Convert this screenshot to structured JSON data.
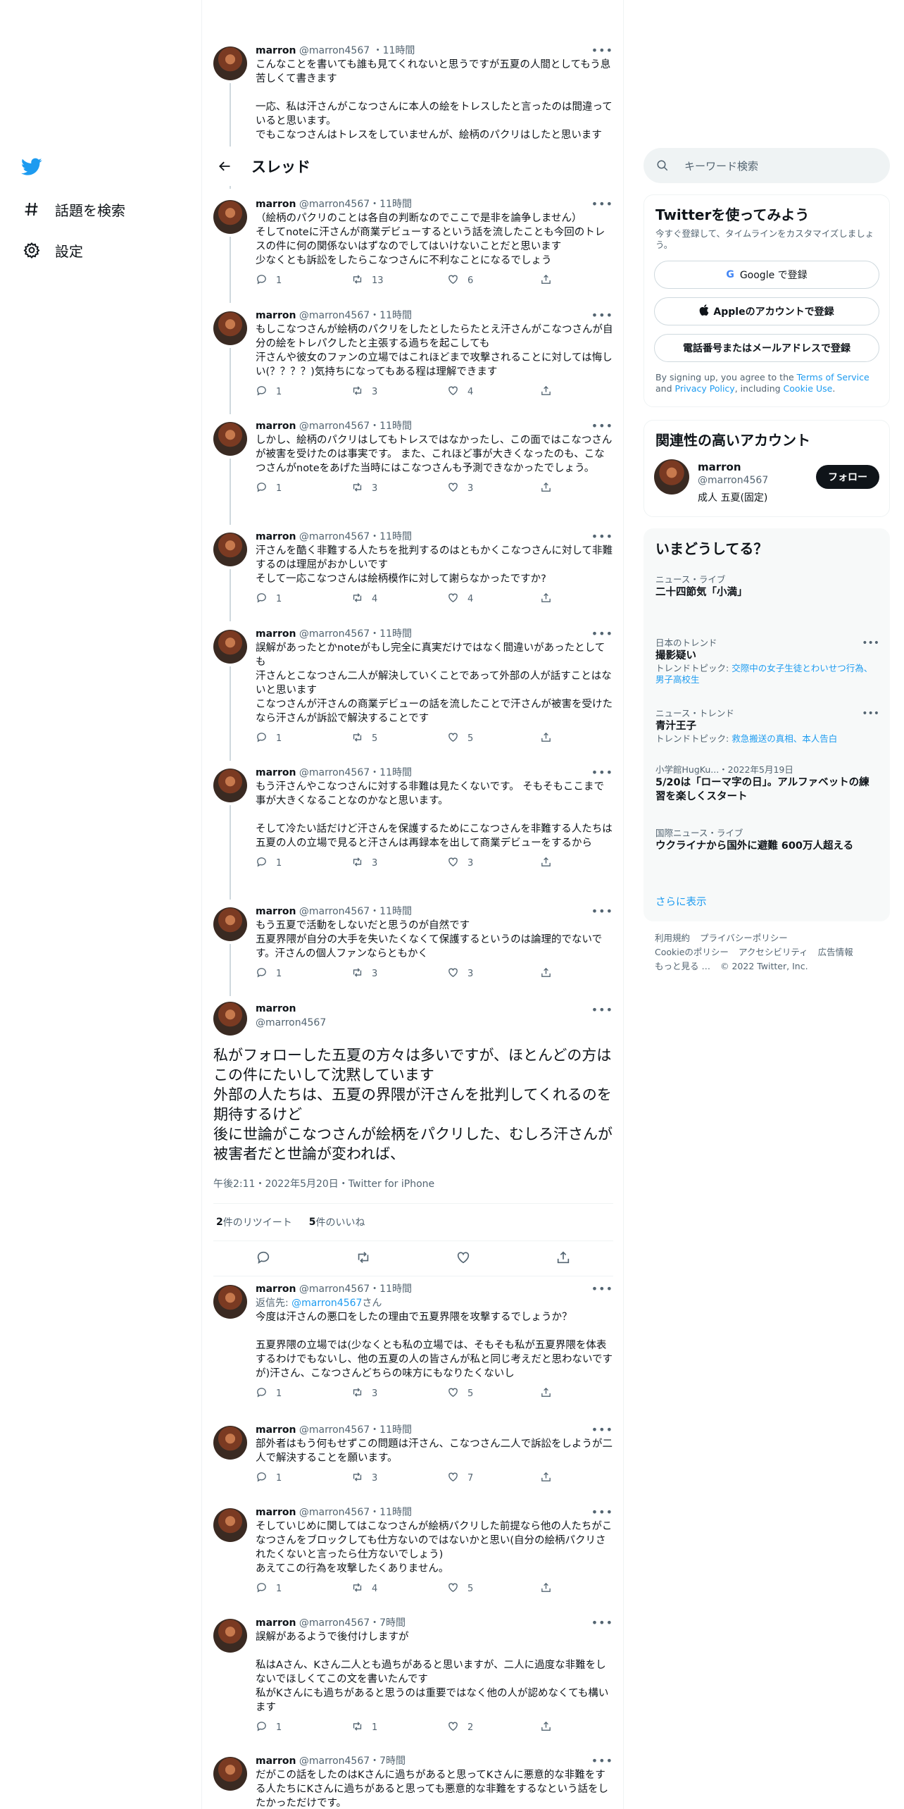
{
  "nav": {
    "explore_label": "話題を検索",
    "settings_label": "設定"
  },
  "header": {
    "title": "スレッド"
  },
  "top_tweet": {
    "name": "marron",
    "handle": "@marron4567",
    "time": "11時間",
    "text": "こんなことを書いても誰も見てくれないと思うですが五夏の人間としてもう息苦しくて書きます\n\n一応、私は汗さんがこなつさんに本人の絵をトレスしたと言ったのは間違っていると思います。\nでもこなつさんはトレスをしていませんが、絵柄のパクリはしたと思います"
  },
  "tweets": [
    {
      "name": "marron",
      "handle": "@marron4567",
      "time": "11時間",
      "text": "（絵柄のパクリのことは各自の判断なのでここで是非を論争しません）\nそしてnoteに汗さんが商業デビューするという話を流したことも今回のトレスの件に何の関係ないはずなのでしてはいけないことだと思います\n少なくとも訴訟をしたらこなつさんに不利なことになるでしょう",
      "reply": "1",
      "rt": "13",
      "like": "6"
    },
    {
      "name": "marron",
      "handle": "@marron4567",
      "time": "11時間",
      "text": "もしこなつさんが絵柄のパクリをしたとしたらたとえ汗さんがこなつさんが自分の絵をトレパクしたと主張する過ちを起こしても\n汗さんや彼女のファンの立場ではこれほどまで攻撃されることに対しては悔しい(？？？？)気持ちになってもある程は理解できます",
      "reply": "1",
      "rt": "3",
      "like": "4"
    },
    {
      "name": "marron",
      "handle": "@marron4567",
      "time": "11時間",
      "text": "しかし、絵柄のパクリはしてもトレスではなかったし、この面ではこなつさんが被害を受けたのは事実です。 また、これほど事が大きくなったのも、こなつさんがnoteをあげた当時にはこなつさんも予測できなかったでしょう。",
      "reply": "1",
      "rt": "3",
      "like": "3"
    },
    {
      "name": "marron",
      "handle": "@marron4567",
      "time": "11時間",
      "text": "汗さんを酷く非難する人たちを批判するのはともかくこなつさんに対して非難するのは理屈がおかしいです\nそして一応こなつさんは絵柄模作に対して謝らなかったですか?",
      "reply": "1",
      "rt": "4",
      "like": "4"
    },
    {
      "name": "marron",
      "handle": "@marron4567",
      "time": "11時間",
      "text": "誤解があったとかnoteがもし完全に真実だけではなく間違いがあったとしても\n汗さんとこなつさん二人が解決していくことであって外部の人が話すことはないと思います\nこなつさんが汗さんの商業デビューの話を流したことで汗さんが被害を受けたなら汗さんが訴訟で解決することです",
      "reply": "1",
      "rt": "5",
      "like": "5"
    },
    {
      "name": "marron",
      "handle": "@marron4567",
      "time": "11時間",
      "text": "もう汗さんやこなつさんに対する非難は見たくないです。 そもそもここまで事が大きくなることなのかなと思います。\n\nそして冷たい話だけど汗さんを保護するためにこなつさんを非難する人たちは五夏の人の立場で見ると汗さんは再録本を出して商業デビューをするから",
      "reply": "1",
      "rt": "3",
      "like": "3"
    },
    {
      "name": "marron",
      "handle": "@marron4567",
      "time": "11時間",
      "text": "もう五夏で活動をしないだと思うのが自然です\n五夏界隈が自分の大手を失いたくなくて保護するというのは論理的でないです。汗さんの個人ファンならともかく",
      "reply": "1",
      "rt": "3",
      "like": "3"
    }
  ],
  "main_tweet": {
    "name": "marron",
    "handle": "@marron4567",
    "text": "私がフォローした五夏の方々は多いですが、ほとんどの方はこの件にたいして沈黙しています\n外部の人たちは、五夏の界隈が汗さんを批判してくれるのを期待するけど\n後に世論がこなつさんが絵柄をパクリした、むしろ汗さんが被害者だと世論が変われば、",
    "time": "午後2:11・2022年5月20日・Twitter for iPhone",
    "retweets_num": "2",
    "retweets_label": "件のリツイート",
    "likes_num": "5",
    "likes_label": "件のいいね"
  },
  "replies": [
    {
      "name": "marron",
      "handle": "@marron4567",
      "time": "11時間",
      "reply_prefix": "返信先: ",
      "reply_link": "@marron4567",
      "reply_suffix": "さん",
      "text": "今度は汗さんの悪口をしたの理由で五夏界隈を攻撃するでしょうか？\n\n五夏界隈の立場では(少なくとも私の立場では、そもそも私が五夏界隈を体表するわけでもないし、他の五夏の人の皆さんが私と同じ考えだと思わないですが)汗さん、こなつさんどちらの味方にもなりたくないし",
      "reply": "1",
      "rt": "3",
      "like": "5"
    },
    {
      "name": "marron",
      "handle": "@marron4567",
      "time": "11時間",
      "text": "部外者はもう何もせずこの問題は汗さん、こなつさん二人で訴訟をしようが二人で解決することを願います。",
      "reply": "1",
      "rt": "3",
      "like": "7"
    },
    {
      "name": "marron",
      "handle": "@marron4567",
      "time": "11時間",
      "text": "そしていじめに関してはこなつさんが絵柄パクリした前提なら他の人たちがこなつさんをブロックしても仕方ないのではないかと思い(自分の絵柄パクリされたくないと言ったら仕方ないでしょう)\nあえてこの行為を攻撃したくありません。",
      "reply": "1",
      "rt": "4",
      "like": "5"
    },
    {
      "name": "marron",
      "handle": "@marron4567",
      "time": "7時間",
      "text": "誤解があるようで後付けしますが\n\n私はAさん、Kさん二人とも過ちがあると思いますが、二人に過度な非難をしないでほしくてこの文を書いたんです\n私がKさんにも過ちがあると思うのは重要ではなく他の人が認めなくても構います",
      "reply": "1",
      "rt": "1",
      "like": "2"
    },
    {
      "name": "marron",
      "handle": "@marron4567",
      "time": "7時間",
      "text": "だがこの話をしたのはKさんに過ちがあると思ってKさんに悪意的な非難をする人たちにKさんに過ちがあると思っても悪意的な非難をするなという話をしたかっただけです。",
      "reply": "",
      "rt": "",
      "like": ""
    }
  ],
  "search": {
    "placeholder": "キーワード検索"
  },
  "signup": {
    "title": "Twitterを使ってみよう",
    "subtitle": "今すぐ登録して、タイムラインをカスタマイズしましょう。",
    "google": "Google で登録",
    "apple": "Appleのアカウントで登録",
    "phone": "電話番号またはメールアドレスで登録",
    "legal_pre": "By signing up, you agree to the ",
    "tos": "Terms of Service",
    "legal_and": " and ",
    "privacy": "Privacy Policy",
    "legal_incl": ", including ",
    "cookie": "Cookie Use",
    "legal_end": "."
  },
  "related": {
    "title": "関連性の高いアカウント",
    "name": "marron",
    "handle": "@marron4567",
    "bio": "成人 五夏(固定)",
    "follow": "フォロー"
  },
  "trends": {
    "title": "いまどうしてる？",
    "items": [
      {
        "ctx": "ニュース・ライブ",
        "title": "二十四節気「小満」",
        "topic_label": "",
        "topic_links": ""
      },
      {
        "ctx": "日本のトレンド",
        "title": "撮影疑い",
        "topic_label": "トレンドトピック: ",
        "topic_links": "交際中の女子生徒とわいせつ行為、男子高校生"
      },
      {
        "ctx": "ニュース・トレンド",
        "title": "青汁王子",
        "topic_label": "トレンドトピック: ",
        "topic_links": "救急搬送の真相、本人告白"
      },
      {
        "ctx": "小学館HugKu...・2022年5月19日",
        "title": "5/20は「ローマ字の日」。アルファベットの練習を楽しくスタート",
        "topic_label": "",
        "topic_links": ""
      },
      {
        "ctx": "国際ニュース・ライブ",
        "title": "ウクライナから国外に避難 600万人超える",
        "topic_label": "",
        "topic_links": ""
      }
    ],
    "show_more": "さらに表示"
  },
  "footer": {
    "links": [
      "利用規約",
      "プライバシーポリシー",
      "Cookieのポリシー",
      "アクセシビリティ",
      "広告情報",
      "もっと見る …",
      "© 2022 Twitter, Inc."
    ]
  },
  "colors": {
    "accent": "#1d9bf0",
    "text": "#0f1419",
    "muted": "#536471"
  }
}
